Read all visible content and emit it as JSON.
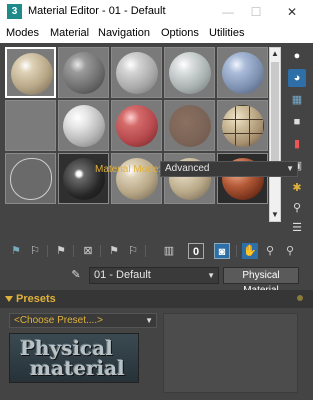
{
  "window": {
    "app_icon": "3",
    "title": "Material Editor - 01 - Default",
    "minimize": "—",
    "maximize": "☐",
    "close": "✕"
  },
  "menu": {
    "items": [
      "Modes",
      "Material",
      "Navigation",
      "Options",
      "Utilities"
    ]
  },
  "slots": [
    {
      "icon": "sphere-beige"
    },
    {
      "icon": "sphere-dark-grey"
    },
    {
      "icon": "sphere-light-grey"
    },
    {
      "icon": "sphere-pale-grey"
    },
    {
      "icon": "sphere-blue-grey"
    },
    {
      "icon": "flat-grey"
    },
    {
      "icon": "sphere-white"
    },
    {
      "icon": "sphere-red"
    },
    {
      "icon": "sphere-brown-flat"
    },
    {
      "icon": "sphere-tile"
    },
    {
      "icon": "sphere-outline"
    },
    {
      "icon": "sphere-dark"
    },
    {
      "icon": "sphere-beige"
    },
    {
      "icon": "sphere-beige"
    },
    {
      "icon": "sphere-copper"
    }
  ],
  "side_tools": [
    "sample-type-icon",
    "backlight-icon",
    "background-checker-icon",
    "uv-tiling-icon",
    "video-color-check-icon",
    "make-preview-icon",
    "options-icon",
    "select-by-material-icon",
    "material-navigator-icon"
  ],
  "toolbar": {
    "zero_label": "0"
  },
  "material": {
    "name": "01 - Default",
    "type": "Physical Material"
  },
  "presets": {
    "header": "Presets",
    "choose": "<Choose Preset....>",
    "logo_line1": "Physical",
    "logo_line2": "material",
    "mode_label": "Material Mode:",
    "mode_value": "Advanced"
  },
  "colors": {
    "accent": "#e0b13a",
    "panel": "#444444",
    "selected_border": "#ffffff"
  }
}
